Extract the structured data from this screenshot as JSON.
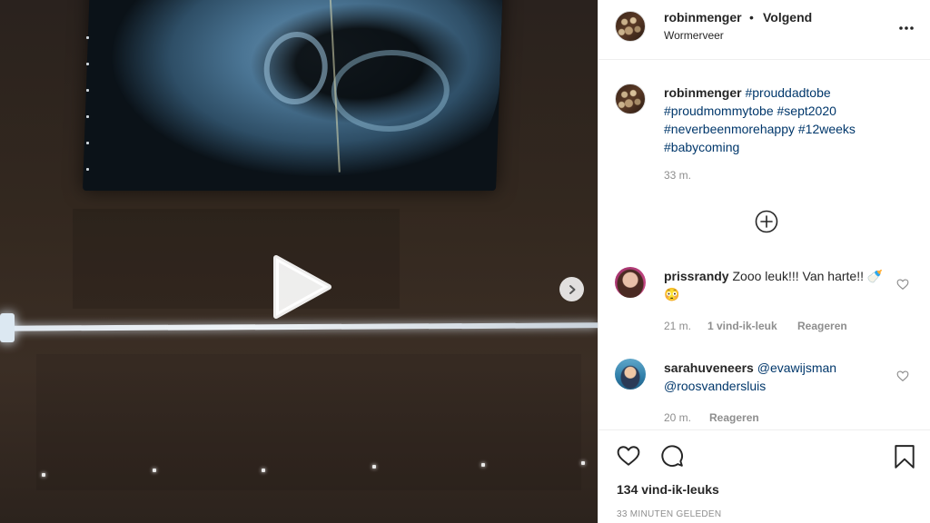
{
  "header": {
    "username": "robinmenger",
    "separator": "•",
    "follow_status": "Volgend",
    "location": "Wormerveer",
    "more_label": "•••"
  },
  "caption": {
    "username": "robinmenger",
    "tags": [
      "#prouddadtobe",
      "#proudmommytobe",
      "#sept2020",
      "#neverbeenmorehappy",
      "#12weeks",
      "#babycoming"
    ],
    "time": "33 m."
  },
  "comments": [
    {
      "username": "prissrandy",
      "text": "Zooo leuk!!! Van harte!! 🍼😳",
      "time": "21 m.",
      "likes": "1 vind-ik-leuk",
      "reply": "Reageren"
    },
    {
      "username": "sarahuveneers",
      "mentions": [
        "@evawijsman",
        "@roosvandersluis"
      ],
      "time": "20 m.",
      "reply": "Reageren"
    }
  ],
  "actions": {
    "likes_count": "134 vind-ik-leuks",
    "timestamp": "33 MINUTEN GELEDEN"
  },
  "icons": {
    "play": "play-icon",
    "next": "chevron-right-icon",
    "more": "more-horizontal-icon",
    "load_more": "plus-circle-icon",
    "like": "heart-icon",
    "comment": "comment-icon",
    "save": "bookmark-icon"
  },
  "colors": {
    "text": "#262626",
    "secondary": "#8e8e8e",
    "link": "#00376b",
    "border": "#efefef"
  }
}
